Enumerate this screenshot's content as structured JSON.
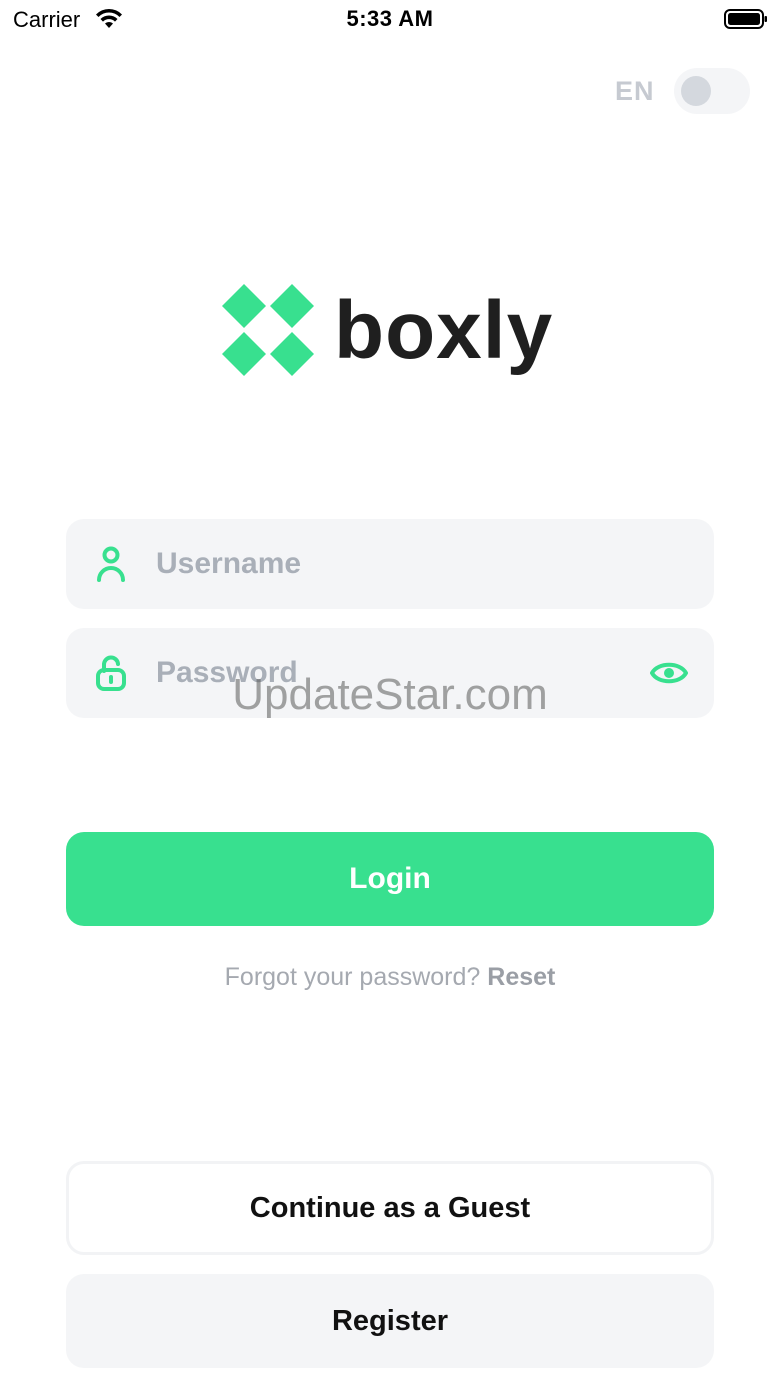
{
  "status_bar": {
    "carrier": "Carrier",
    "time": "5:33 AM"
  },
  "language": {
    "label": "EN",
    "toggle_on": false
  },
  "brand": {
    "name": "boxly",
    "logo_color": "#38e08f",
    "text_color": "#1f1f1f"
  },
  "form": {
    "username_placeholder": "Username",
    "password_placeholder": "Password",
    "username_icon": "user-icon",
    "password_icon": "unlock-icon",
    "visibility_icon": "eye-icon"
  },
  "actions": {
    "login_label": "Login",
    "forgot_text": "Forgot your password?",
    "reset_label": "Reset",
    "guest_label": "Continue as a Guest",
    "register_label": "Register"
  },
  "watermark": "UpdateStar.com",
  "colors": {
    "accent": "#38e08f",
    "field_bg": "#f4f5f7",
    "placeholder": "#a9afb8"
  }
}
